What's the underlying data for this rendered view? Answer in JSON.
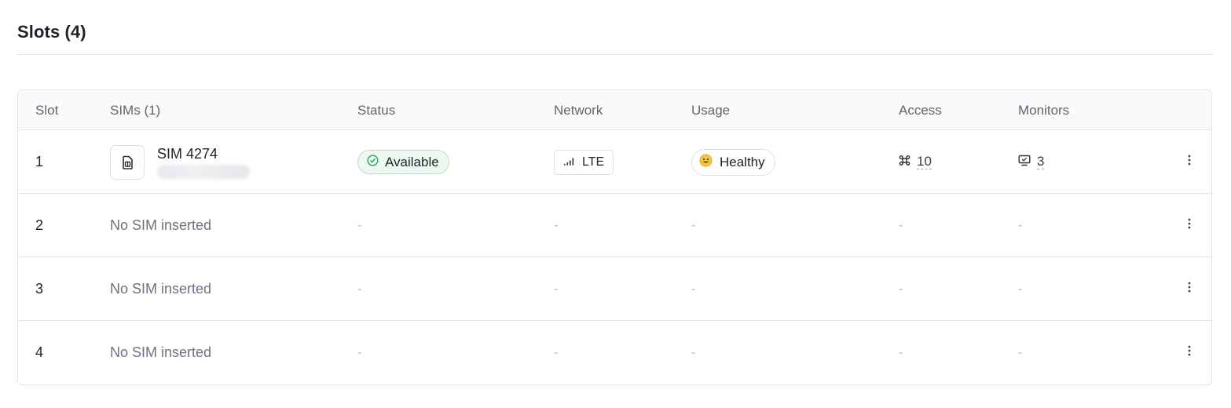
{
  "section": {
    "title": "Slots (4)"
  },
  "table": {
    "headers": {
      "slot": "Slot",
      "sims": "SIMs (1)",
      "status": "Status",
      "network": "Network",
      "usage": "Usage",
      "access": "Access",
      "monitors": "Monitors"
    },
    "rows": [
      {
        "slot": "1",
        "sim_name": "SIM 4274",
        "status": "Available",
        "network": "LTE",
        "usage": "Healthy",
        "access_count": "10",
        "monitors_count": "3"
      },
      {
        "slot": "2",
        "empty_text": "No SIM inserted",
        "status": "-",
        "network": "-",
        "usage": "-",
        "access": "-",
        "monitors": "-"
      },
      {
        "slot": "3",
        "empty_text": "No SIM inserted",
        "status": "-",
        "network": "-",
        "usage": "-",
        "access": "-",
        "monitors": "-"
      },
      {
        "slot": "4",
        "empty_text": "No SIM inserted",
        "status": "-",
        "network": "-",
        "usage": "-",
        "access": "-",
        "monitors": "-"
      }
    ]
  },
  "icons": {
    "sim": "sim-card-icon",
    "status": "check-circle-icon",
    "network": "signal-bars-icon",
    "usage": "smiley-emoji-icon",
    "access": "command-key-icon",
    "monitors": "monitor-icon",
    "row_menu": "kebab-menu-icon"
  },
  "colors": {
    "status_border": "#b9dfc7",
    "status_bg": "#ecf8f0",
    "status_icon": "#2f9e5b",
    "muted": "#6b7280",
    "dash": "#b0b5bc"
  }
}
